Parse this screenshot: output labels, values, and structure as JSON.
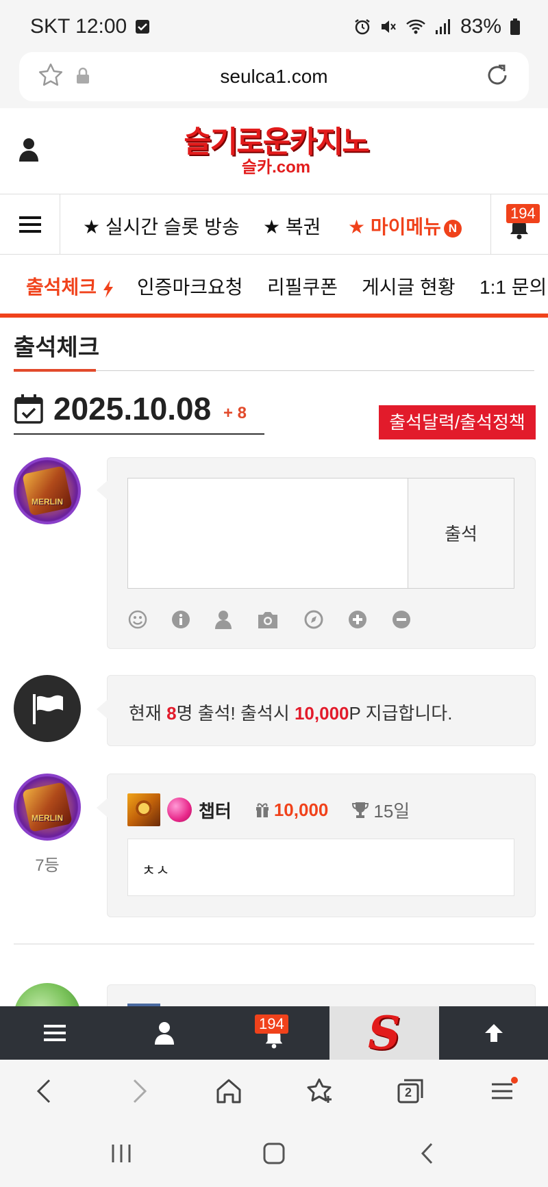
{
  "status_bar": {
    "carrier_time": "SKT 12:00",
    "battery": "83%"
  },
  "browser": {
    "url": "seulca1.com",
    "tab_count": "2"
  },
  "logo": {
    "line1": "슬기로운카지노",
    "line2": "슬카.com"
  },
  "nav": {
    "items": [
      "★ 실시간 슬롯 방송",
      "★ 복권",
      "★ 마이메뉴"
    ],
    "new_badge": "N",
    "notification_count": "194"
  },
  "sub_tabs": [
    "출석체크",
    "인증마크요청",
    "리필쿠폰",
    "게시글 현황",
    "1:1 문의"
  ],
  "page": {
    "title": "출석체크",
    "date": "2025.10.08",
    "date_delta": "+ 8",
    "calendar_button": "출석달력/출석정책",
    "attend_button": "출석",
    "avatar_text": "MERLIN"
  },
  "notice": {
    "prefix": "현재 ",
    "count": "8",
    "mid": "명 출석! 출석시 ",
    "points": "10,000",
    "suffix": "P 지급합니다."
  },
  "entry": {
    "rank": "7등",
    "username": "챕터",
    "points": "10,000",
    "streak": "15일",
    "comment": "ㅊㅅ"
  },
  "bottom_nav": {
    "notification_count": "194",
    "s_logo": "S"
  }
}
